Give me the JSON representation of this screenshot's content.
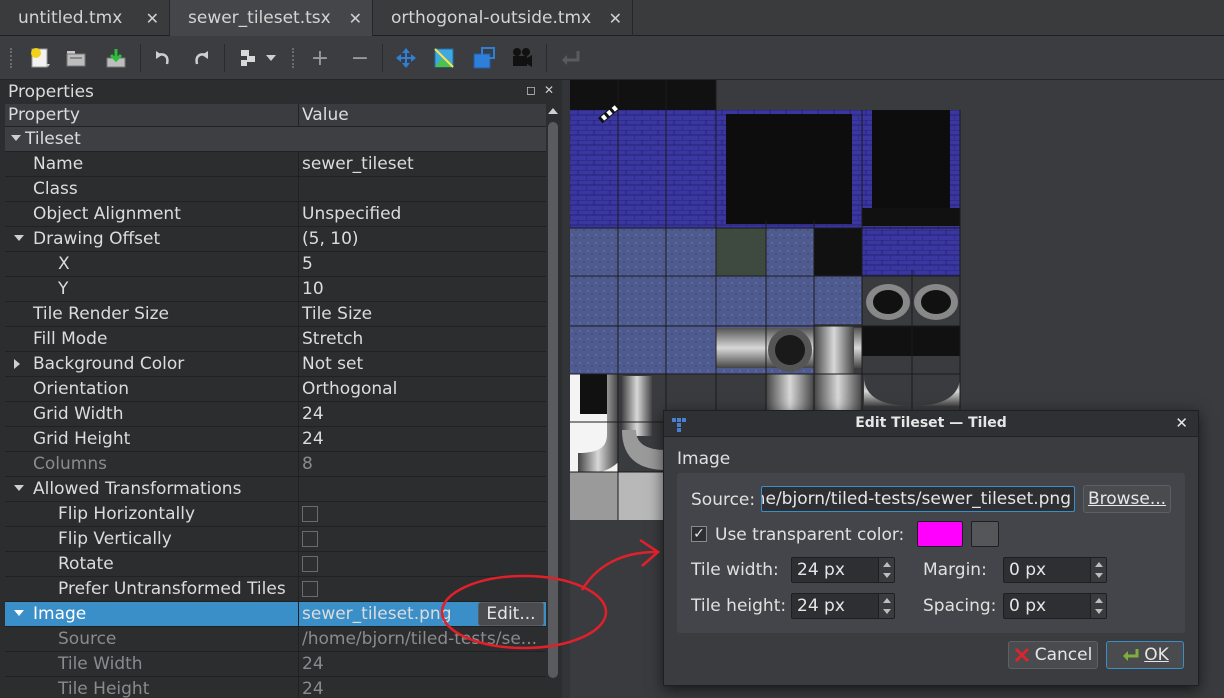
{
  "tabs": [
    {
      "label": "untitled.tmx"
    },
    {
      "label": "sewer_tileset.tsx"
    },
    {
      "label": "orthogonal-outside.tmx"
    }
  ],
  "tab_close_glyph": "✕",
  "toolbar": {
    "icons": [
      "new-file-icon",
      "open-folder-icon",
      "save-icon",
      "undo-icon",
      "redo-icon",
      "stamp-icon",
      "dropdown-arrow-icon",
      "add-icon",
      "remove-icon",
      "move-icon",
      "terrain-icon",
      "tile-collision-icon",
      "animation-icon",
      "apply-icon"
    ],
    "add_glyph": "+",
    "remove_glyph": "−"
  },
  "properties": {
    "panel_title": "Properties",
    "col_property": "Property",
    "col_value": "Value",
    "rows": [
      {
        "name": "Tileset",
        "value": "",
        "indent": 0,
        "group": true,
        "arrow": "down"
      },
      {
        "name": "Name",
        "value": "sewer_tileset",
        "indent": 1
      },
      {
        "name": "Class",
        "value": "",
        "indent": 1
      },
      {
        "name": "Object Alignment",
        "value": "Unspecified",
        "indent": 1
      },
      {
        "name": "Drawing Offset",
        "value": "(5, 10)",
        "indent": 1,
        "arrow": "down"
      },
      {
        "name": "X",
        "value": "5",
        "indent": 2
      },
      {
        "name": "Y",
        "value": "10",
        "indent": 2
      },
      {
        "name": "Tile Render Size",
        "value": "Tile Size",
        "indent": 1
      },
      {
        "name": "Fill Mode",
        "value": "Stretch",
        "indent": 1
      },
      {
        "name": "Background Color",
        "value": "Not set",
        "indent": 1,
        "arrow": "right"
      },
      {
        "name": "Orientation",
        "value": "Orthogonal",
        "indent": 1
      },
      {
        "name": "Grid Width",
        "value": "24",
        "indent": 1
      },
      {
        "name": "Grid Height",
        "value": "24",
        "indent": 1
      },
      {
        "name": "Columns",
        "value": "8",
        "indent": 1,
        "dim": true
      },
      {
        "name": "Allowed Transformations",
        "value": "",
        "indent": 1,
        "arrow": "down"
      },
      {
        "name": "Flip Horizontally",
        "value": "",
        "indent": 2,
        "checkbox": true
      },
      {
        "name": "Flip Vertically",
        "value": "",
        "indent": 2,
        "checkbox": true
      },
      {
        "name": "Rotate",
        "value": "",
        "indent": 2,
        "checkbox": true
      },
      {
        "name": "Prefer Untransformed Tiles",
        "value": "",
        "indent": 2,
        "checkbox": true
      },
      {
        "name": "Image",
        "value": "sewer_tileset.png",
        "indent": 1,
        "arrow": "down",
        "selected": true,
        "edit": true
      },
      {
        "name": "Source",
        "value": "/home/bjorn/tiled-tests/se...",
        "indent": 2,
        "dim": true
      },
      {
        "name": "Tile Width",
        "value": "24",
        "indent": 2,
        "dim": true
      },
      {
        "name": "Tile Height",
        "value": "24",
        "indent": 2,
        "dim": true
      }
    ],
    "edit_label": "Edit..."
  },
  "dialog": {
    "title": "Edit Tileset — Tiled",
    "close_glyph": "✕",
    "section": "Image",
    "source_label": "Source:",
    "source_value": "/home/bjorn/tiled-tests/sewer_tileset.png",
    "browse_label": "Browse...",
    "transparent_label": "Use transparent color:",
    "transparent_checked": "✓",
    "transparent_color": "#ff00ff",
    "tile_width_label": "Tile width:",
    "tile_width_value": "24 px",
    "tile_height_label": "Tile height:",
    "tile_height_value": "24 px",
    "margin_label": "Margin:",
    "margin_value": "0 px",
    "spacing_label": "Spacing:",
    "spacing_value": "0 px",
    "cancel_label": "Cancel",
    "ok_label": "OK"
  },
  "colors": {
    "selection": "#3a8fc9",
    "annotation": "#e0202a",
    "brick": "#3d3a9a",
    "stone": "#4e5a8a"
  }
}
